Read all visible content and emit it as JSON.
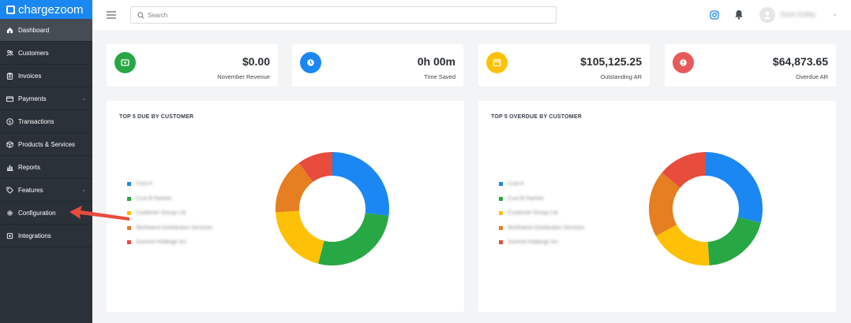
{
  "app": {
    "brand": "chargezoom"
  },
  "sidebar": {
    "items": [
      {
        "label": "Dashboard",
        "icon": "home-icon",
        "active": true
      },
      {
        "label": "Customers",
        "icon": "users-icon"
      },
      {
        "label": "Invoices",
        "icon": "clipboard-icon"
      },
      {
        "label": "Payments",
        "icon": "credit-card-icon",
        "has_submenu": true
      },
      {
        "label": "Transactions",
        "icon": "dollar-circle-icon"
      },
      {
        "label": "Products & Services",
        "icon": "box-icon"
      },
      {
        "label": "Reports",
        "icon": "bar-chart-icon"
      },
      {
        "label": "Features",
        "icon": "tag-icon",
        "has_submenu": true
      },
      {
        "label": "Configuration",
        "icon": "gear-icon"
      },
      {
        "label": "Integrations",
        "icon": "puzzle-icon"
      }
    ]
  },
  "topbar": {
    "search_placeholder": "Search",
    "search_value": "",
    "user_name": "Kevin Kelley"
  },
  "stats": [
    {
      "value": "$0.00",
      "label": "November Revenue",
      "icon": "wallet-icon",
      "color": "#28a745"
    },
    {
      "value": "0h 00m",
      "label": "Time Saved",
      "icon": "clock-icon",
      "color": "#1b87f2"
    },
    {
      "value": "$105,125.25",
      "label": "Outstanding AR",
      "icon": "calendar-icon",
      "color": "#ffc107"
    },
    {
      "value": "$64,873.65",
      "label": "Overdue AR",
      "icon": "alert-icon",
      "color": "#e85a5a"
    }
  ],
  "chart_data": [
    {
      "type": "pie",
      "title": "TOP 5 DUE BY CUSTOMER",
      "series": [
        {
          "name": "Cust A",
          "value": 27,
          "color": "#1b87f2"
        },
        {
          "name": "Cust B Partner",
          "value": 27,
          "color": "#28a745"
        },
        {
          "name": "Customer Group Ltd",
          "value": 20,
          "color": "#ffc107"
        },
        {
          "name": "Northwest Distribution Services",
          "value": 16,
          "color": "#e67e22"
        },
        {
          "name": "Summit Holdings Inc",
          "value": 10,
          "color": "#e74c3c"
        }
      ]
    },
    {
      "type": "pie",
      "title": "TOP 5 OVERDUE BY CUSTOMER",
      "series": [
        {
          "name": "Cust A",
          "value": 29,
          "color": "#1b87f2"
        },
        {
          "name": "Cust B Partner",
          "value": 20,
          "color": "#28a745"
        },
        {
          "name": "Customer Group Ltd",
          "value": 18,
          "color": "#ffc107"
        },
        {
          "name": "Northwest Distribution Services",
          "value": 19,
          "color": "#e67e22"
        },
        {
          "name": "Summit Holdings Inc",
          "value": 14,
          "color": "#e74c3c"
        }
      ]
    }
  ],
  "colors": {
    "sidebar_bg": "#2b3138",
    "brand": "#1b87f2",
    "annotation_arrow": "#e74c3c"
  }
}
